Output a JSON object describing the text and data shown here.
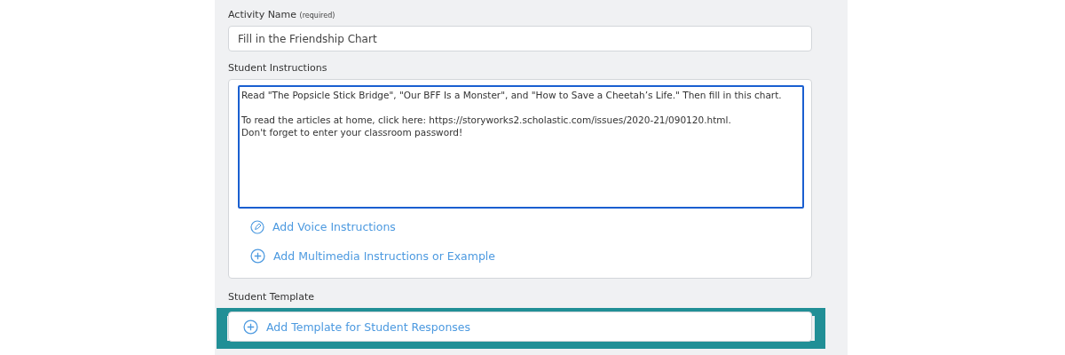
{
  "activity_name": {
    "label": "Activity Name",
    "hint": "(required)",
    "value": "Fill in the Friendship Chart"
  },
  "student_instructions": {
    "label": "Student Instructions",
    "value": "Read \"The Popsicle Stick Bridge\", \"Our BFF Is a Monster\", and \"How to Save a Cheetah’s Life.\" Then fill in this chart.\n\nTo read the articles at home, click here: https://storyworks2.scholastic.com/issues/2020-21/090120.html.\nDon't forget to enter your classroom password!",
    "focused": true,
    "actions": [
      {
        "kind": "voice",
        "label": "Add Voice Instructions"
      },
      {
        "kind": "add",
        "label": "Add Multimedia Instructions or Example"
      }
    ]
  },
  "student_template": {
    "label": "Student Template",
    "action": {
      "kind": "add",
      "label": "Add Template for Student Responses"
    },
    "highlighted": true
  }
}
